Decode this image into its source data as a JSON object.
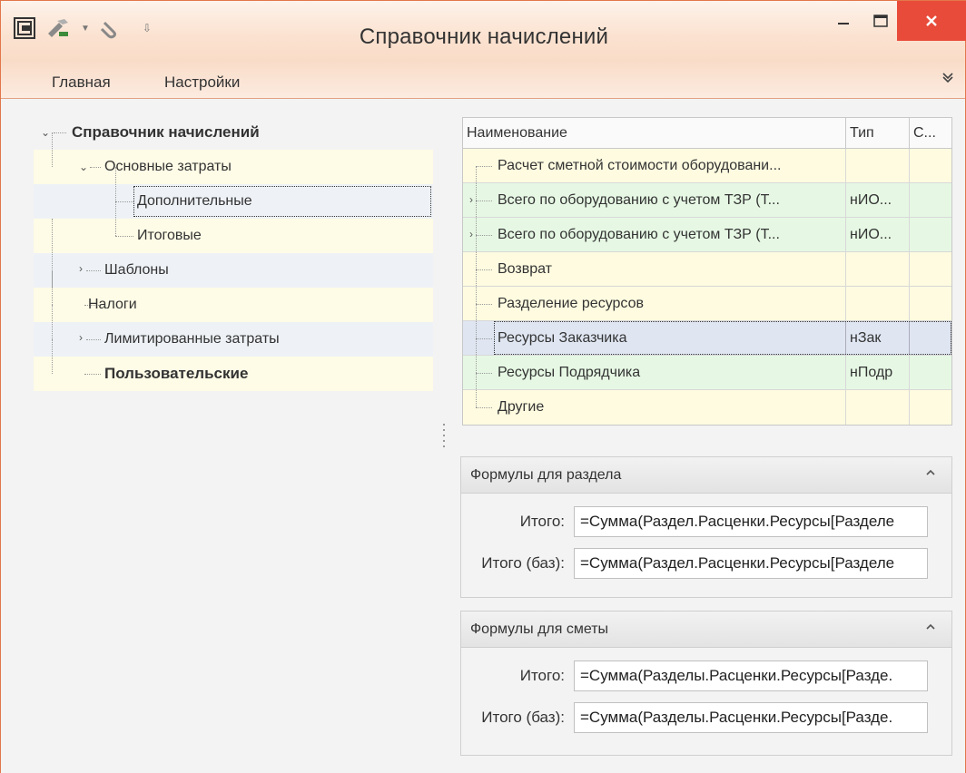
{
  "window": {
    "title": "Справочник начислений"
  },
  "ribbon": {
    "tabs": [
      "Главная",
      "Настройки"
    ]
  },
  "tree": {
    "root": "Справочник начислений",
    "items": [
      {
        "label": "Основные затраты"
      },
      {
        "label": "Дополнительные"
      },
      {
        "label": "Итоговые"
      },
      {
        "label": "Шаблоны"
      },
      {
        "label": "Налоги"
      },
      {
        "label": "Лимитированные затраты"
      },
      {
        "label": "Пользовательские"
      }
    ]
  },
  "grid": {
    "columns": [
      "Наименование",
      "Тип",
      "С..."
    ],
    "rows": [
      {
        "name": "Расчет сметной стоимости оборудовани...",
        "type": "",
        "c": ""
      },
      {
        "name": "Всего по оборудованию с учетом ТЗР (Т...",
        "type": "нИО...",
        "c": ""
      },
      {
        "name": "Всего по оборудованию с учетом ТЗР (Т...",
        "type": "нИО...",
        "c": ""
      },
      {
        "name": "Возврат",
        "type": "",
        "c": ""
      },
      {
        "name": "Разделение ресурсов",
        "type": "",
        "c": ""
      },
      {
        "name": "Ресурсы Заказчика",
        "type": "нЗак",
        "c": ""
      },
      {
        "name": "Ресурсы Подрядчика",
        "type": "нПодр",
        "c": ""
      },
      {
        "name": "Другие",
        "type": "",
        "c": ""
      }
    ]
  },
  "section_formulas": {
    "title": "Формулы для раздела",
    "total_label": "Итого:",
    "total_value": "=Сумма(Раздел.Расценки.Ресурсы[Разделе",
    "total_base_label": "Итого (баз):",
    "total_base_value": "=Сумма(Раздел.Расценки.Ресурсы[Разделе"
  },
  "estimate_formulas": {
    "title": "Формулы для сметы",
    "total_label": "Итого:",
    "total_value": "=Сумма(Разделы.Расценки.Ресурсы[Разде.",
    "total_base_label": "Итого (баз):",
    "total_base_value": "=Сумма(Разделы.Расценки.Ресурсы[Разде."
  },
  "colors": {
    "close_button": "#e84b3a",
    "title_bg": "#fbe2d0",
    "row_yellow": "#fefbe0",
    "row_green": "#e6f8e4",
    "row_selected": "#dfe6f2"
  }
}
